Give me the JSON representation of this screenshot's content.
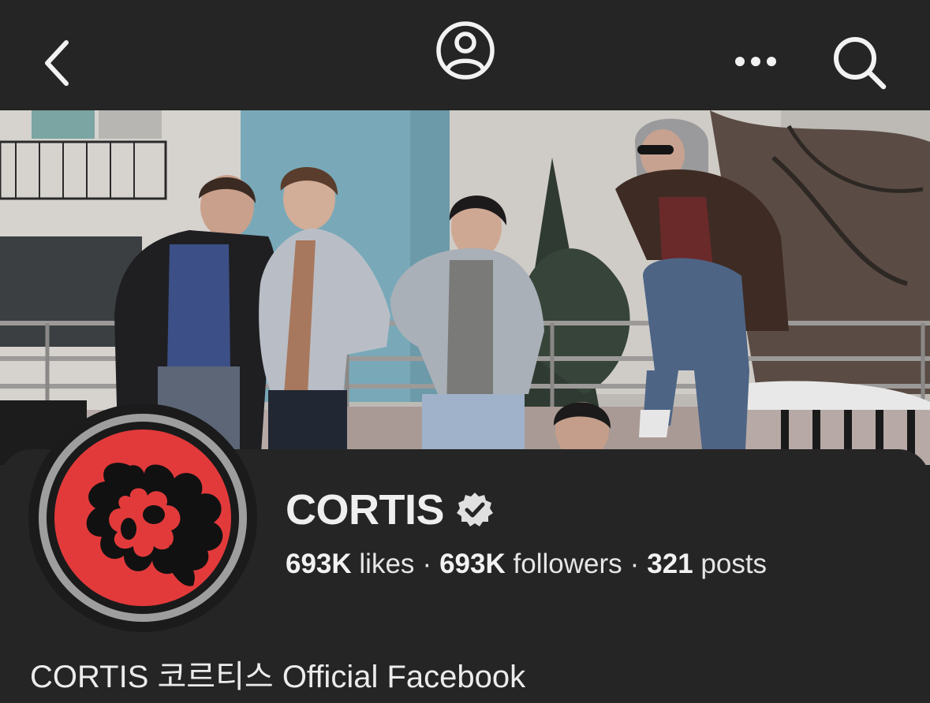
{
  "nav": {
    "back_icon": "chevron-left-icon",
    "profile_icon": "user-circle-icon",
    "more_icon": "more-horizontal-icon",
    "search_icon": "search-icon"
  },
  "page": {
    "name": "CORTIS",
    "verified_icon": "verified-badge-icon",
    "likes_count": "693K",
    "likes_label": "likes",
    "followers_count": "693K",
    "followers_label": "followers",
    "posts_count": "321",
    "posts_label": "posts",
    "separator": "·",
    "bio": "CORTIS 코르티스 Official Facebook"
  },
  "cover": {
    "subject": "cover-photo"
  },
  "colors": {
    "background": "#252525",
    "avatar_red": "#e23a3b",
    "avatar_ring": "#9e9e9e",
    "text": "#eaeaea"
  }
}
